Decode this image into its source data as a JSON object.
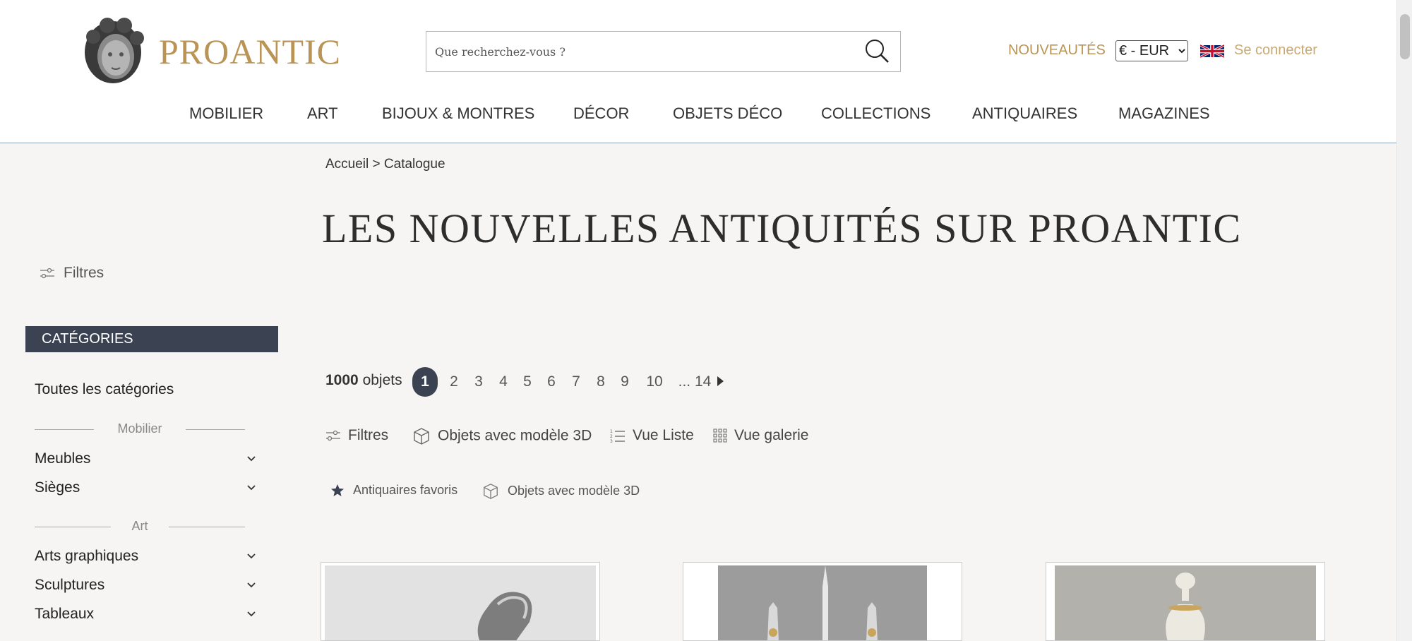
{
  "header": {
    "logo_text": "PROANTIC",
    "search_placeholder": "Que recherchez-vous ?",
    "nouveautes": "NOUVEAUTÉS",
    "currency": "€ - EUR",
    "login": "Se connecter"
  },
  "nav": [
    "MOBILIER",
    "ART",
    "BIJOUX & MONTRES",
    "DÉCOR",
    "OBJETS DÉCO",
    "COLLECTIONS",
    "ANTIQUAIRES",
    "MAGAZINES"
  ],
  "breadcrumb": {
    "home": "Accueil",
    "sep": ">",
    "current": "Catalogue"
  },
  "page_title": "LES NOUVELLES ANTIQUITÉS SUR PROANTIC",
  "sidebar": {
    "filters_label": "Filtres",
    "categories_header": "CATÉGORIES",
    "all_categories": "Toutes les catégories",
    "sections": [
      {
        "label": "Mobilier",
        "items": [
          "Meubles",
          "Sièges"
        ]
      },
      {
        "label": "Art",
        "items": [
          "Arts graphiques",
          "Sculptures",
          "Tableaux"
        ]
      }
    ]
  },
  "results": {
    "count": "1000",
    "count_label": "objets",
    "pages": [
      "1",
      "2",
      "3",
      "4",
      "5",
      "6",
      "7",
      "8",
      "9",
      "10",
      "... 14"
    ],
    "current_page": "1"
  },
  "toolbar": {
    "filters": "Filtres",
    "objects_3d": "Objets avec modèle 3D",
    "list_view": "Vue Liste",
    "gallery_view": "Vue galerie"
  },
  "quick_filters": {
    "favorites": "Antiquaires favoris",
    "objects_3d": "Objets avec modèle 3D"
  },
  "colors": {
    "brand_gold": "#b99455",
    "dark_slate": "#3b4352",
    "background": "#f6f5f3"
  }
}
